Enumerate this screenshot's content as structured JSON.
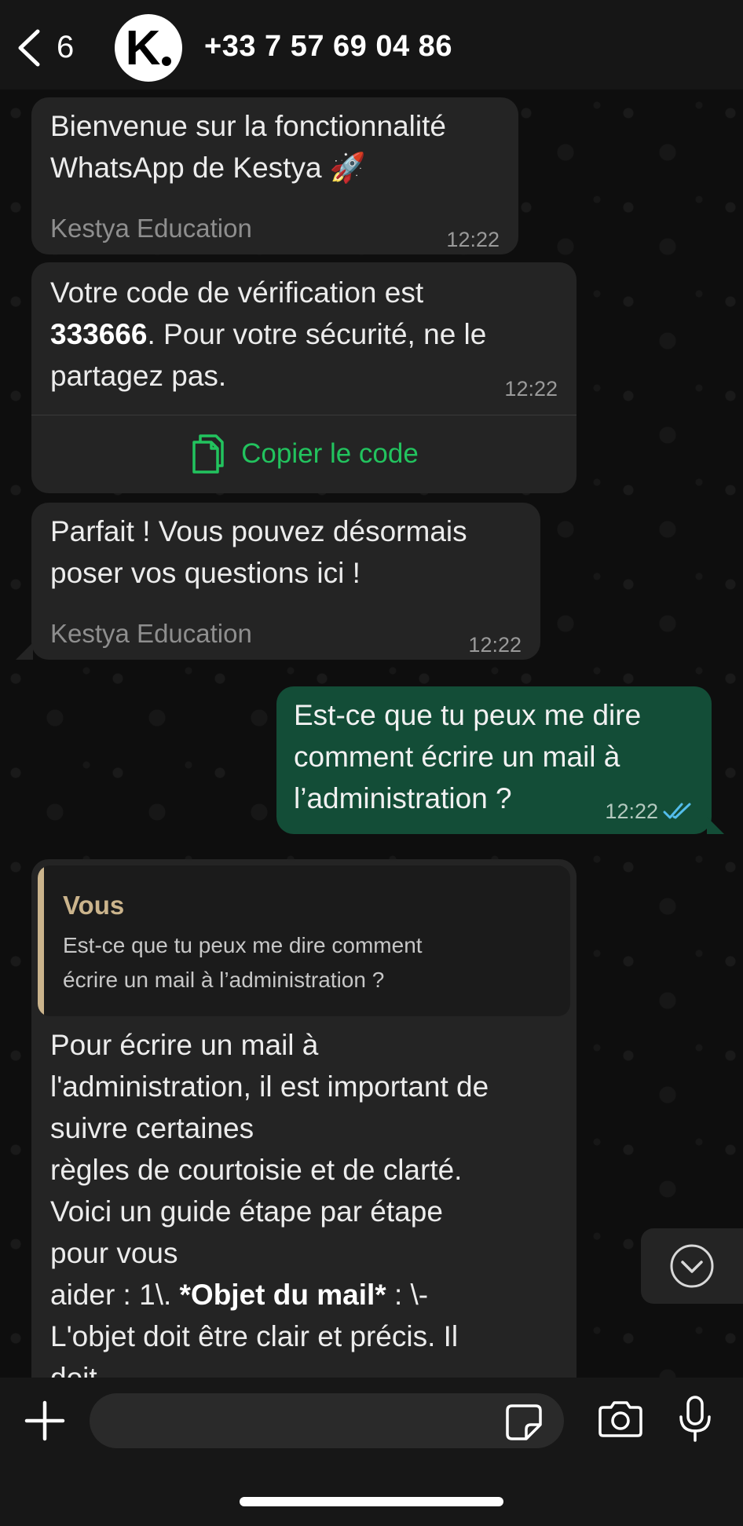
{
  "header": {
    "back_count": "6",
    "avatar_letter": "K",
    "contact_name": "+33 7 57 69 04 86"
  },
  "messages": [
    {
      "text_lines": [
        "Bienvenue sur la fonctionnalité",
        "WhatsApp de Kestya 🚀"
      ],
      "sender": "Kestya Education",
      "time": "12:22"
    },
    {
      "line1": "Votre code de vérification est",
      "code": "333666",
      "line2_rest": ". Pour votre sécurité, ne le",
      "line3": "partagez pas.",
      "time": "12:22",
      "copy_label": "Copier le code"
    },
    {
      "text_lines": [
        "Parfait ! Vous pouvez désormais",
        "poser vos questions ici !"
      ],
      "sender": "Kestya Education",
      "time": "12:22"
    },
    {
      "text_lines": [
        "Est-ce que tu peux me dire",
        "comment écrire un mail à",
        "l’administration ?"
      ],
      "time": "12:22"
    },
    {
      "quote_author": "Vous",
      "quote_lines": [
        "Est-ce que tu peux me dire comment",
        "écrire un mail à l’administration ?"
      ],
      "body_lines": [
        "Pour écrire un mail à",
        "l'administration, il est important de",
        "suivre certaines",
        "règles de courtoisie et de clarté.",
        "Voici un guide étape par étape",
        "pour vous"
      ],
      "aider_prefix": "aider : 1\\. ",
      "aider_bold": "*Objet du mail*",
      "aider_suffix": " : \\-",
      "body_after": [
        "L'objet doit être clair et précis. Il",
        "doit"
      ]
    }
  ],
  "colors": {
    "accent_green": "#22c35e",
    "outgoing_bubble": "#134d37",
    "incoming_bubble": "#242424",
    "quote_accent": "#cbb48c",
    "read_ticks": "#53bdeb"
  }
}
